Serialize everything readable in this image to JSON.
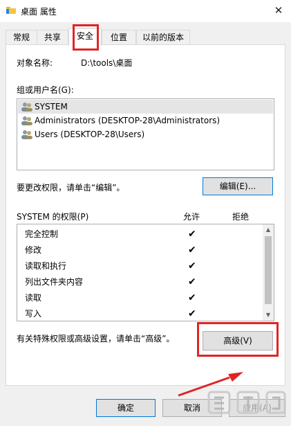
{
  "window": {
    "title": "桌面 属性",
    "close_label": "✕"
  },
  "tabs": [
    {
      "label": "常规"
    },
    {
      "label": "共享"
    },
    {
      "label": "安全"
    },
    {
      "label": "位置"
    },
    {
      "label": "以前的版本"
    }
  ],
  "security": {
    "object_name_label": "对象名称:",
    "object_name_value": "D:\\tools\\桌面",
    "groups_label": "组或用户名(G):",
    "users": [
      {
        "name": "SYSTEM"
      },
      {
        "name": "Administrators (DESKTOP-28\\Administrators)"
      },
      {
        "name": "Users (DESKTOP-28\\Users)"
      }
    ],
    "change_permissions_text": "要更改权限，请单击“编辑”。",
    "edit_button": "编辑(E)...",
    "permissions_header": "SYSTEM 的权限(P)",
    "allow_header": "允许",
    "deny_header": "拒绝",
    "permissions": [
      {
        "name": "完全控制",
        "allow": "✔",
        "deny": ""
      },
      {
        "name": "修改",
        "allow": "✔",
        "deny": ""
      },
      {
        "name": "读取和执行",
        "allow": "✔",
        "deny": ""
      },
      {
        "name": "列出文件夹内容",
        "allow": "✔",
        "deny": ""
      },
      {
        "name": "读取",
        "allow": "✔",
        "deny": ""
      },
      {
        "name": "写入",
        "allow": "✔",
        "deny": ""
      }
    ],
    "advanced_text": "有关特殊权限或高级设置，请单击“高级”。",
    "advanced_button": "高级(V)"
  },
  "footer": {
    "ok_button": "确定",
    "cancel_button": "取消",
    "apply_button": "应用(A)"
  },
  "colors": {
    "highlight": "#e02424",
    "accent": "#0078d7"
  }
}
